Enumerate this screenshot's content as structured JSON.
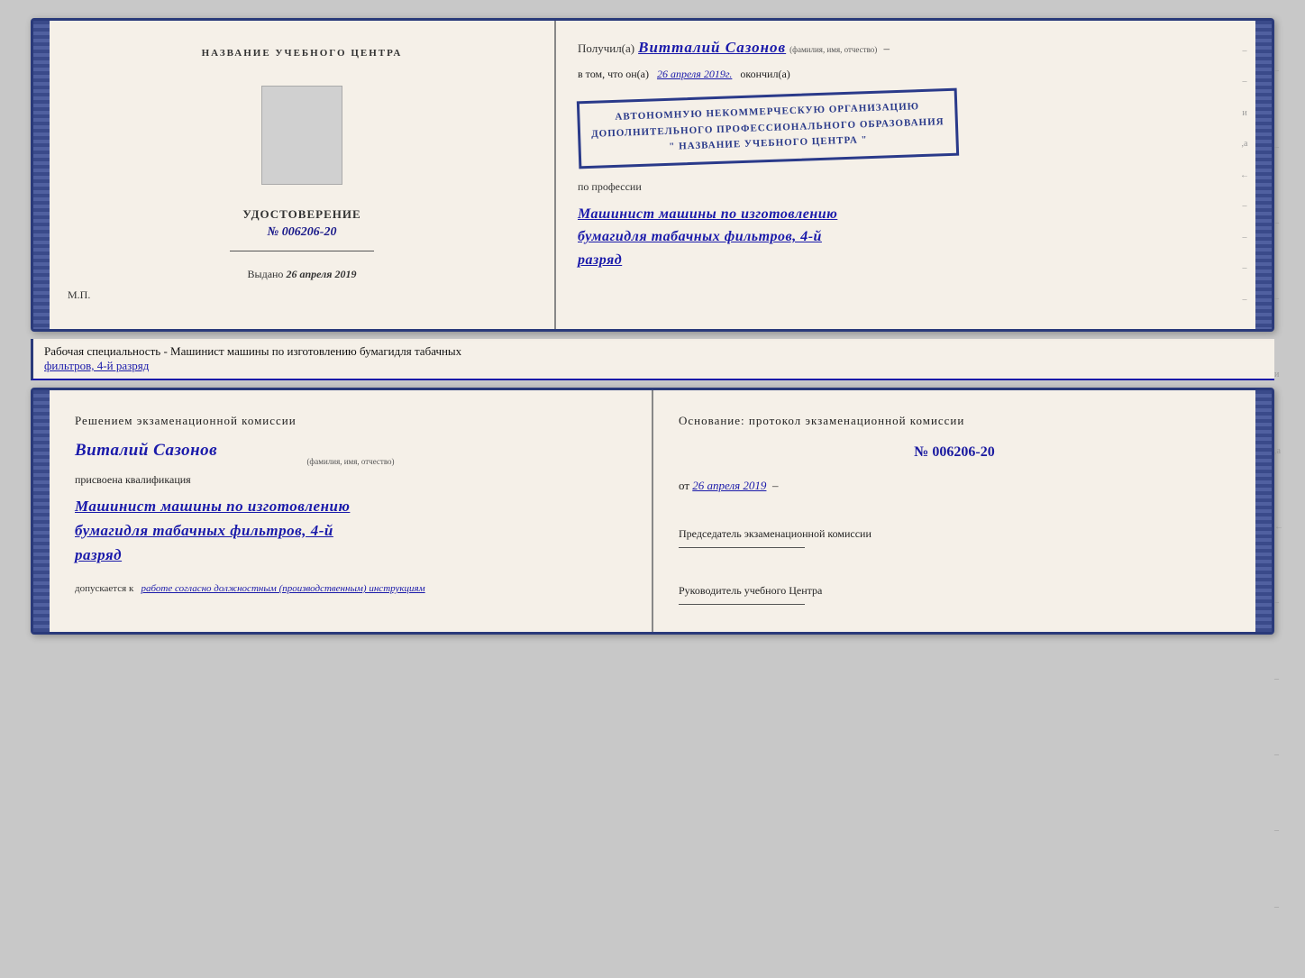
{
  "top_booklet": {
    "left": {
      "header": "НАЗВАНИЕ УЧЕБНОГО ЦЕНТРА",
      "title": "УДОСТОВЕРЕНИЕ",
      "number": "№ 006206-20",
      "issued_label": "Выдано",
      "issued_date": "26 апреля 2019",
      "mp_label": "М.П."
    },
    "right": {
      "received_prefix": "Получил(а)",
      "recipient_name": "Витталий  Сазонов",
      "fio_label": "(фамилия, имя, отчество)",
      "in_that_prefix": "в том, что он(а)",
      "date_value": "26 апреля 2019г.",
      "finished_label": "окончил(а)",
      "stamp_line1": "АВТОНОМНУЮ НЕКОММЕРЧЕСКУЮ ОРГАНИЗАЦИЮ",
      "stamp_line2": "ДОПОЛНИТЕЛЬНОГО ПРОФЕССИОНАЛЬНОГО ОБРАЗОВАНИЯ",
      "stamp_line3": "\" НАЗВАНИЕ УЧЕБНОГО ЦЕНТРА \"",
      "profession_label": "по профессии",
      "profession_line1": "Машинист машины по изготовлению",
      "profession_line2": "бумагидля табачных фильтров, 4-й",
      "profession_line3": "разряд"
    }
  },
  "caption": {
    "text_prefix": "Рабочая специальность - Машинист машины по изготовлению бумагидля табачных",
    "text_underline": "фильтров, 4-й разряд"
  },
  "bottom_booklet": {
    "left": {
      "header": "Решением  экзаменационной  комиссии",
      "person_name": "Виталий  Сазонов",
      "fio_label": "(фамилия, имя, отчество)",
      "assigned_label": "присвоена квалификация",
      "profession_line1": "Машинист машины по изготовлению",
      "profession_line2": "бумагидля табачных фильтров, 4-й",
      "profession_line3": "разряд",
      "admits_prefix": "допускается к",
      "admits_handwritten": "работе согласно должностным (производственным) инструкциям"
    },
    "right": {
      "header": "Основание: протокол экзаменационной  комиссии",
      "number": "№ 006206-20",
      "date_prefix": "от",
      "date_value": "26 апреля 2019",
      "chairman_label": "Председатель экзаменационной комиссии",
      "director_label": "Руководитель учебного Центра"
    }
  }
}
